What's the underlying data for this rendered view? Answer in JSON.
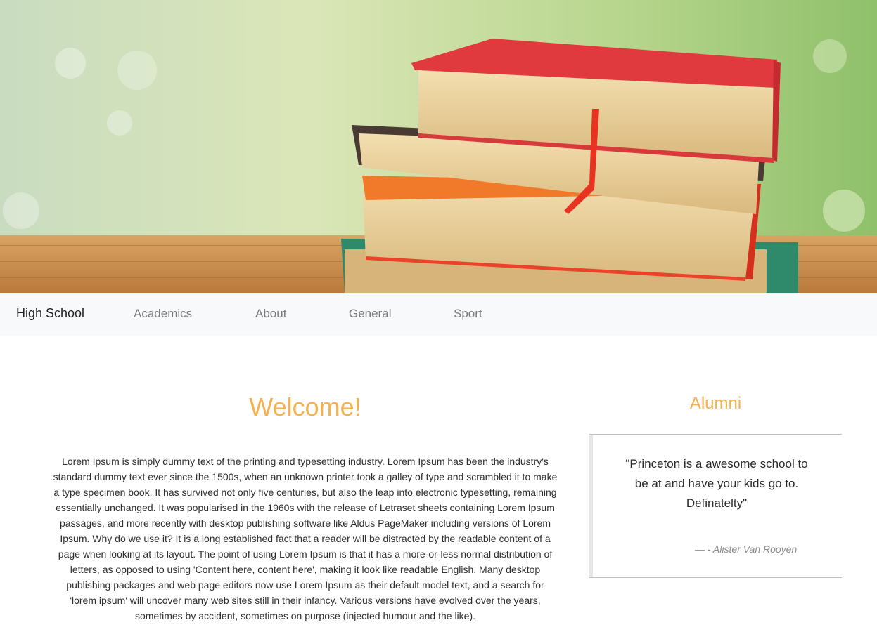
{
  "hero": {
    "image": "stack-of-books-photo"
  },
  "navbar": {
    "brand": "High School",
    "links": [
      "Academics",
      "About",
      "General",
      "Sport"
    ]
  },
  "welcome": {
    "title": "Welcome!",
    "body": "Lorem Ipsum is simply dummy text of the printing and typesetting industry. Lorem Ipsum has been the industry's standard dummy text ever since the 1500s, when an unknown printer took a galley of type and scrambled it to make a type specimen book. It has survived not only five centuries, but also the leap into electronic typesetting, remaining essentially unchanged. It was popularised in the 1960s with the release of Letraset sheets containing Lorem Ipsum passages, and more recently with desktop publishing software like Aldus PageMaker including versions of Lorem Ipsum. Why do we use it? It is a long established fact that a reader will be distracted by the readable content of a page when looking at its layout. The point of using Lorem Ipsum is that it has a more-or-less normal distribution of letters, as opposed to using 'Content here, content here', making it look like readable English. Many desktop publishing packages and web page editors now use Lorem Ipsum as their default model text, and a search for 'lorem ipsum' will uncover many web sites still in their infancy. Various versions have evolved over the years, sometimes by accident, sometimes on purpose (injected humour and the like)."
  },
  "alumni": {
    "title": "Alumni",
    "quote": "\"Princeton is a awesome school to be at and have your kids go to. Definatelty\"",
    "author": "— - Alister Van Rooyen"
  },
  "colors": {
    "accent": "#f5b04f",
    "navbar_bg": "#f8f9fa"
  }
}
